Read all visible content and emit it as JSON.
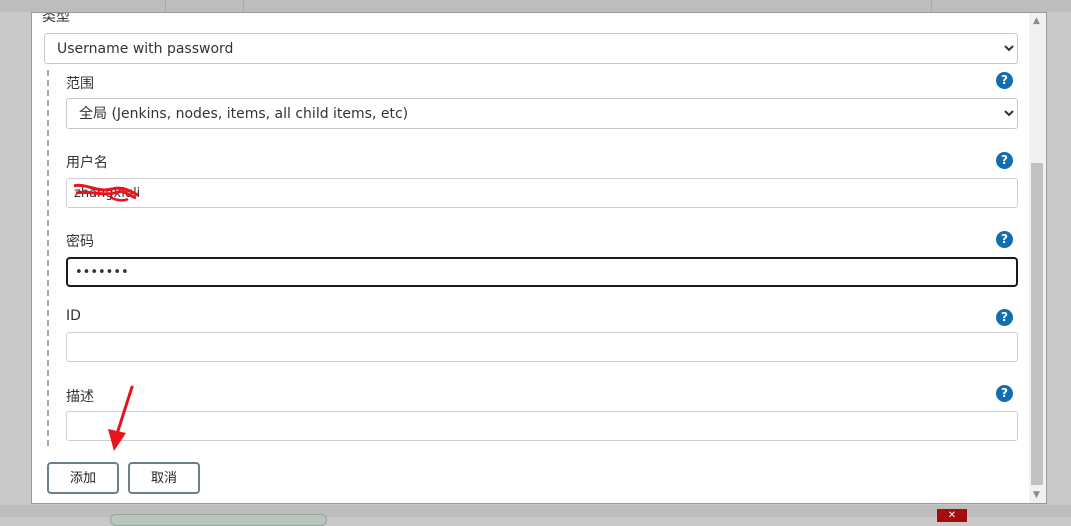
{
  "form": {
    "type_label": "类型",
    "type_value": "Username with password",
    "scope_label": "范围",
    "scope_value": "全局 (Jenkins, nodes, items, all child items, etc)",
    "username_label": "用户名",
    "username_value": "zhangxiuli",
    "password_label": "密码",
    "password_value": "•••••••",
    "id_label": "ID",
    "id_value": "",
    "description_label": "描述",
    "description_value": "",
    "help_glyph": "?"
  },
  "buttons": {
    "add_label": "添加",
    "cancel_label": "取消"
  },
  "colors": {
    "help_icon": "#126eb0",
    "annotation_red": "#e8131b"
  }
}
